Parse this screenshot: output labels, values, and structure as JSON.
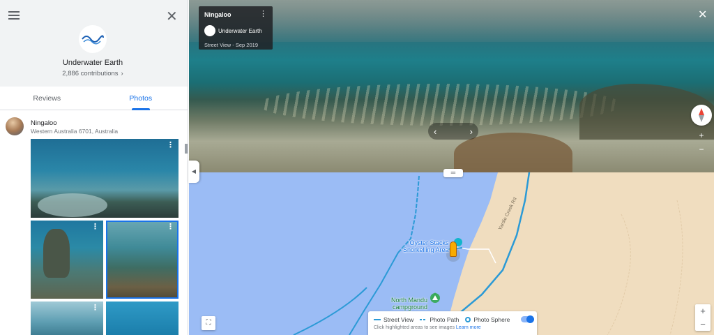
{
  "profile": {
    "name": "Underwater Earth",
    "contributions": "2,886 contributions",
    "logo_text": "Underwater Earth"
  },
  "tabs": [
    {
      "label": "Reviews",
      "active": false
    },
    {
      "label": "Photos",
      "active": true
    }
  ],
  "place": {
    "name": "Ningaloo",
    "address": "Western Australia 6701, Australia"
  },
  "street_view": {
    "title": "Ningaloo",
    "author": "Underwater Earth",
    "date": "Street View - Sep 2019"
  },
  "map": {
    "labels": {
      "oyster_stacks_1": "Oyster Stacks",
      "oyster_stacks_2": "Snorkelling Area",
      "north_mandu_1": "North Mandu",
      "north_mandu_2": "campground",
      "road": "Yardie Creek Rd"
    },
    "legend": {
      "street_view": "Street View",
      "photo_path": "Photo Path",
      "photo_sphere": "Photo Sphere",
      "note": "Click highlighted areas to see images",
      "learn_more": "Learn more"
    },
    "colors": {
      "water": "#9bbcf5",
      "land": "#f0ddbf",
      "coverage": "#2b9ad6",
      "accent": "#1a73e8"
    }
  },
  "icons": {
    "menu": "☰",
    "close": "✕",
    "chevron_right": "›",
    "more": "⋮",
    "prev": "‹",
    "next": "›",
    "zoom_in": "+",
    "zoom_out": "−",
    "collapse": "◀",
    "handle": "═",
    "fullscreen": "⛶"
  }
}
